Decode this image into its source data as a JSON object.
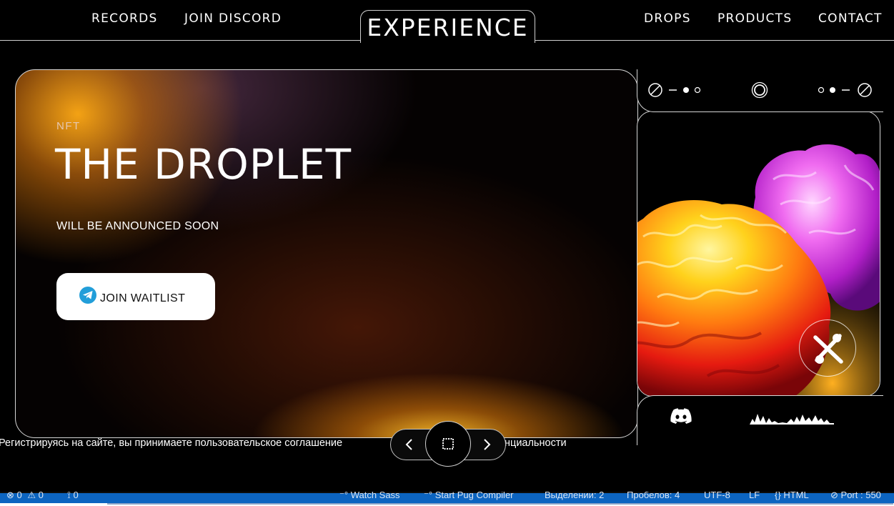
{
  "header": {
    "nav_left": [
      "RECORDS",
      "JOIN DISCORD"
    ],
    "logo": "EXPERIENCE",
    "nav_right": [
      "DROPS",
      "PRODUCTS",
      "CONTACT"
    ]
  },
  "hero": {
    "label": "NFT",
    "title": "THE DROPLET",
    "subtitle": "WILL BE ANNOUNCED SOON",
    "button_label": "JOIN WAITLIST"
  },
  "consent": {
    "left": "Регистрируясь на сайте, вы принимаете пользовательское соглашение",
    "right": "нциальности"
  },
  "statusbar": {
    "errors": "0",
    "warnings": "0",
    "ports": "0",
    "watch_sass": "Watch Sass",
    "pug": "Start Pug Compiler",
    "selection": "Выделении: 2",
    "spaces": "Пробелов: 4",
    "encoding": "UTF-8",
    "eol": "LF",
    "language": "HTML",
    "port": "Port : 550"
  },
  "colors": {
    "accent_orange": "#f5a623",
    "telegram_blue": "#229ed9",
    "statusbar_blue": "#0c64c0"
  }
}
